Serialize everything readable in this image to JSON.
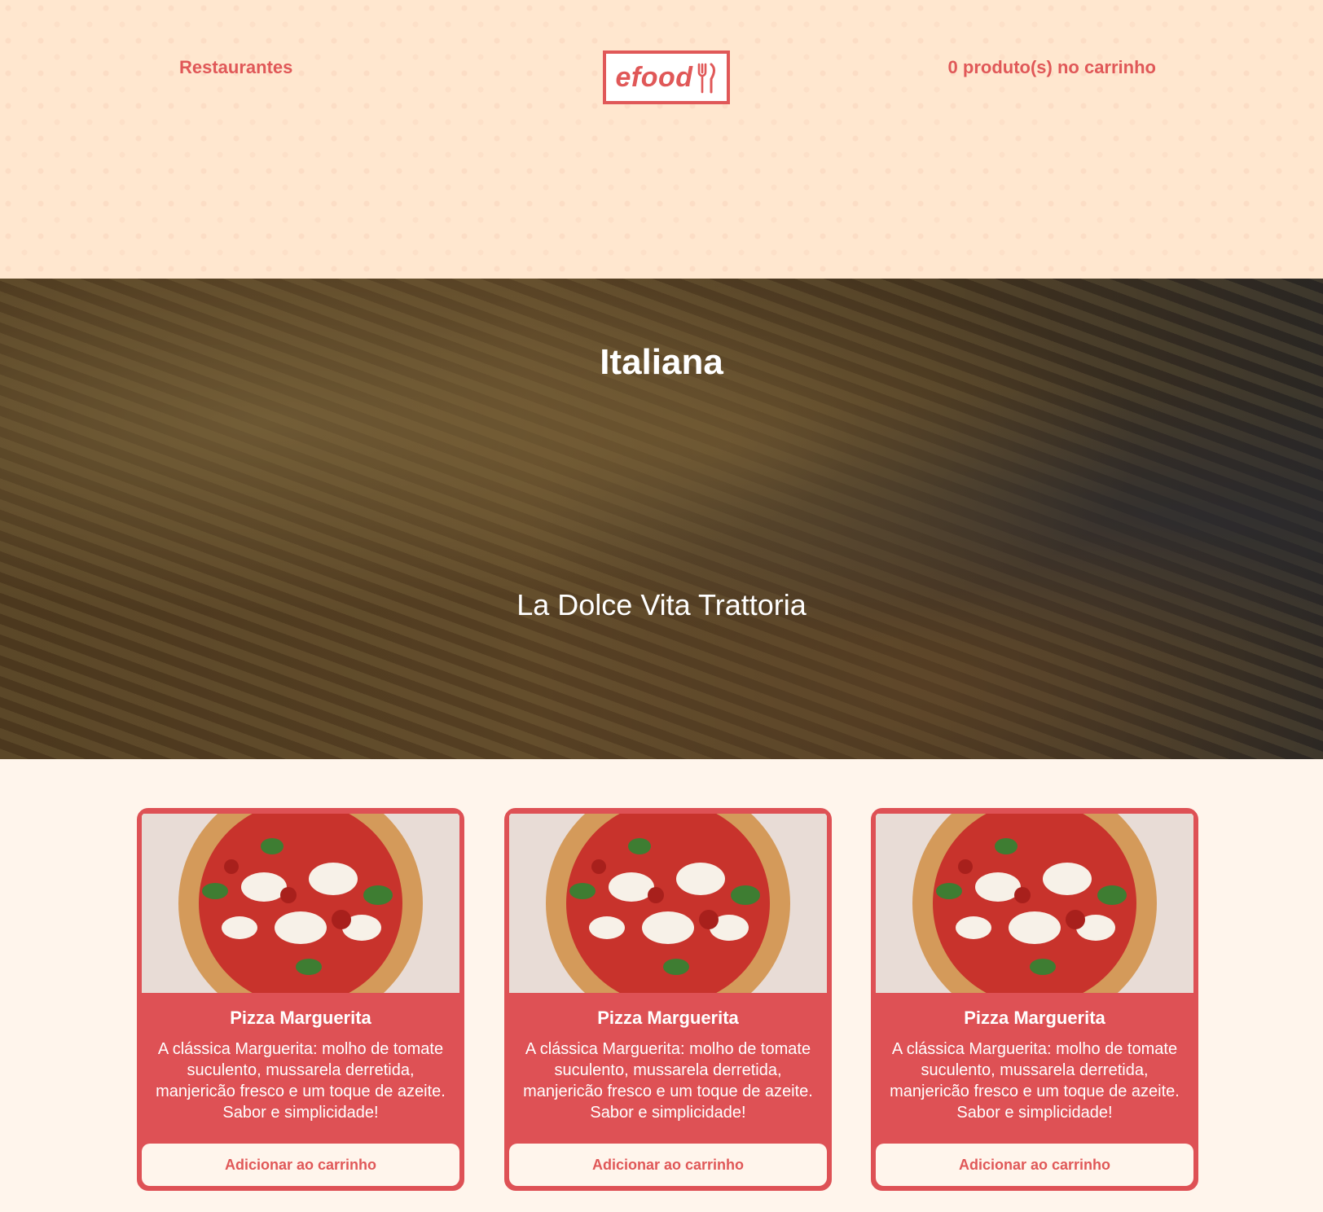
{
  "header": {
    "nav_restaurants": "Restaurantes",
    "logo_text": "efood",
    "cart_status": "0 produto(s) no carrinho"
  },
  "hero": {
    "category": "Italiana",
    "restaurant_name": "La Dolce Vita Trattoria"
  },
  "products": [
    {
      "title": "Pizza Marguerita",
      "description": "A clássica Marguerita: molho de tomate suculento, mussarela derretida, manjericão fresco e um toque de azeite. Sabor e simplicidade!",
      "button_label": "Adicionar ao carrinho"
    },
    {
      "title": "Pizza Marguerita",
      "description": "A clássica Marguerita: molho de tomate suculento, mussarela derretida, manjericão fresco e um toque de azeite. Sabor e simplicidade!",
      "button_label": "Adicionar ao carrinho"
    },
    {
      "title": "Pizza Marguerita",
      "description": "A clássica Marguerita: molho de tomate suculento, mussarela derretida, manjericão fresco e um toque de azeite. Sabor e simplicidade!",
      "button_label": "Adicionar ao carrinho"
    }
  ],
  "colors": {
    "brand": "#E05858",
    "card_background": "#DE5155",
    "header_background": "#FFE7CF",
    "page_background": "#FFF5EC"
  }
}
